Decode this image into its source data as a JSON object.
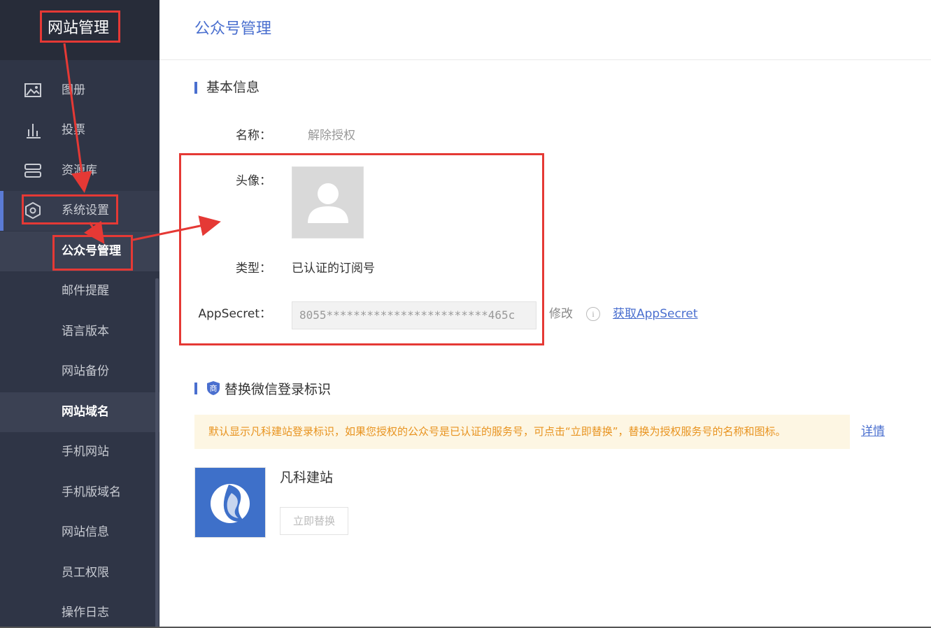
{
  "sidebar": {
    "title": "网站管理",
    "items": [
      {
        "label": "图册",
        "icon": "image-icon"
      },
      {
        "label": "投票",
        "icon": "bar-chart-icon"
      },
      {
        "label": "资源库",
        "icon": "storage-icon"
      },
      {
        "label": "系统设置",
        "icon": "settings-icon"
      }
    ],
    "sub_items": [
      {
        "label": "公众号管理"
      },
      {
        "label": "邮件提醒"
      },
      {
        "label": "语言版本"
      },
      {
        "label": "网站备份"
      },
      {
        "label": "网站域名"
      },
      {
        "label": "手机网站"
      },
      {
        "label": "手机版域名"
      },
      {
        "label": "网站信息"
      },
      {
        "label": "员工权限"
      },
      {
        "label": "操作日志"
      }
    ]
  },
  "page": {
    "title": "公众号管理"
  },
  "basic_info": {
    "section_title": "基本信息",
    "name_label": "名称：",
    "name_value": "解除授权",
    "avatar_label": "头像：",
    "type_label": "类型：",
    "type_value": "已认证的订阅号",
    "secret_label": "AppSecret：",
    "secret_value": "8055************************465c",
    "modify_label": "修改",
    "info_glyph": "i",
    "get_secret_link": "获取AppSecret"
  },
  "wechat_login": {
    "section_title": "替换微信登录标识",
    "badge_text": "商",
    "notice": "默认显示凡科建站登录标识，如果您授权的公众号是已认证的服务号，可点击“立即替换”，替换为授权服务号的名称和图标。",
    "details_link": "详情",
    "brand_name": "凡科建站",
    "replace_button": "立即替换"
  },
  "colors": {
    "sidebar_bg": "#2f3546",
    "accent": "#4a6fcf",
    "annotation": "#e53935",
    "notice_text": "#e8931f",
    "notice_bg": "#fdf6e3",
    "brand_logo_bg": "#3e70c9"
  }
}
